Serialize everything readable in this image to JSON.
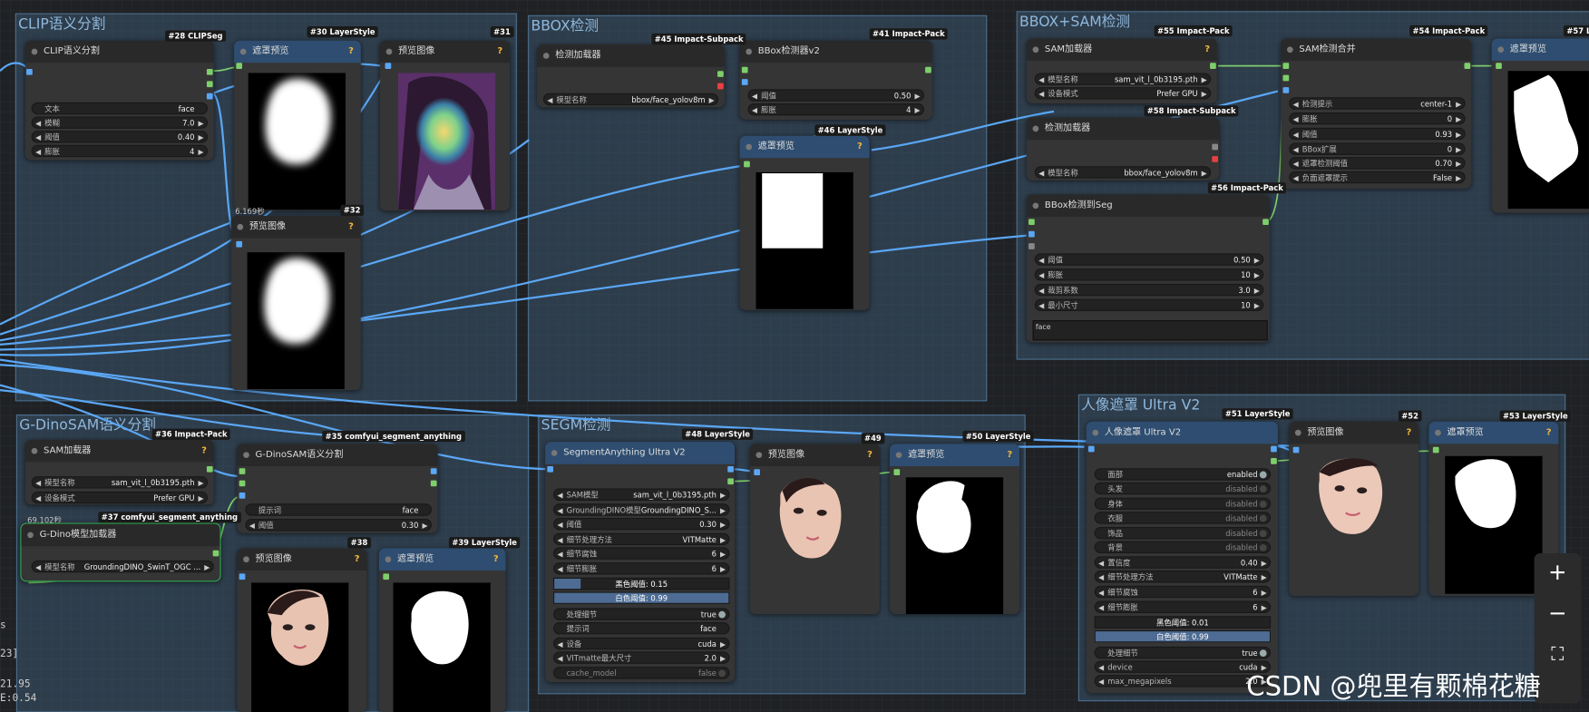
{
  "groups": {
    "clip": "CLIP语义分割",
    "bbox": "BBOX检测",
    "bboxsam": "BBOX+SAM检测",
    "gdino": "G-DinoSAM语义分割",
    "segm": "SEGM检测",
    "person": "人像遮罩 Ultra V2"
  },
  "node28": {
    "badge": "#28 CLIPSeg",
    "title": "CLIP语义分割",
    "w": [
      {
        "label": "文本",
        "value": "face"
      },
      {
        "label": "模糊",
        "value": "7.0"
      },
      {
        "label": "阈值",
        "value": "0.40"
      },
      {
        "label": "膨胀",
        "value": "4"
      }
    ]
  },
  "node30": {
    "badge": "#30 LayerStyle",
    "title": "遮罩预览",
    "time": "6.169秒"
  },
  "node31": {
    "badge": "#31",
    "title": "预览图像"
  },
  "node32": {
    "badge": "#32",
    "title": "预览图像"
  },
  "node45": {
    "badge": "#45 Impact-Subpack",
    "title": "检测加载器",
    "w": [
      {
        "label": "模型名称",
        "value": "bbox/face_yolov8m"
      }
    ]
  },
  "node41": {
    "badge": "#41 Impact-Pack",
    "title": "BBox检测器v2",
    "w": [
      {
        "label": "阈值",
        "value": "0.50"
      },
      {
        "label": "膨胀",
        "value": "4"
      }
    ]
  },
  "node46": {
    "badge": "#46 LayerStyle",
    "title": "遮罩预览"
  },
  "node55": {
    "badge": "#55 Impact-Pack",
    "title": "SAM加载器",
    "w": [
      {
        "label": "模型名称",
        "value": "sam_vit_l_0b3195.pth"
      },
      {
        "label": "设备模式",
        "value": "Prefer GPU"
      }
    ]
  },
  "node58": {
    "badge": "#58 Impact-Subpack",
    "title": "检测加载器",
    "w": [
      {
        "label": "模型名称",
        "value": "bbox/face_yolov8m"
      }
    ]
  },
  "node56": {
    "badge": "#56 Impact-Pack",
    "title": "BBox检测到Seg",
    "w": [
      {
        "label": "阈值",
        "value": "0.50"
      },
      {
        "label": "膨胀",
        "value": "10"
      },
      {
        "label": "裁剪系数",
        "value": "3.0"
      },
      {
        "label": "最小尺寸",
        "value": "10"
      }
    ],
    "text": "face"
  },
  "node54": {
    "badge": "#54 Impact-Pack",
    "title": "SAM检测合并",
    "w": [
      {
        "label": "检测提示",
        "value": "center-1"
      },
      {
        "label": "膨胀",
        "value": "0"
      },
      {
        "label": "阈值",
        "value": "0.93"
      },
      {
        "label": "BBox扩展",
        "value": "0"
      },
      {
        "label": "遮罩检测阈值",
        "value": "0.70"
      },
      {
        "label": "负面遮罩提示",
        "value": "False"
      }
    ]
  },
  "node57": {
    "badge": "#57 La",
    "title": "遮罩预览"
  },
  "node36": {
    "badge": "#36 Impact-Pack",
    "title": "SAM加载器",
    "w": [
      {
        "label": "模型名称",
        "value": "sam_vit_l_0b3195.pth"
      },
      {
        "label": "设备模式",
        "value": "Prefer GPU"
      }
    ],
    "time": "69.102秒"
  },
  "node37": {
    "badge": "#37 comfyui_segment_anything",
    "title": "G-Dino模型加载器",
    "w": [
      {
        "label": "模型名称",
        "value": "GroundingDINO_SwinT_OGC ..."
      }
    ]
  },
  "node35": {
    "badge": "#35 comfyui_segment_anything",
    "title": "G-DinoSAM语义分割",
    "w": [
      {
        "label": "提示词",
        "value": "face"
      },
      {
        "label": "阈值",
        "value": "0.30"
      }
    ]
  },
  "node38": {
    "badge": "#38",
    "title": "预览图像"
  },
  "node39": {
    "badge": "#39 LayerStyle",
    "title": "遮罩预览"
  },
  "node48": {
    "badge": "#48 LayerStyle",
    "title": "SegmentAnything Ultra V2",
    "w": [
      {
        "label": "SAM模型",
        "value": "sam_vit_l_0b3195.pth"
      },
      {
        "label": "GroundingDINO模型",
        "value": "GroundingDINO_S..."
      },
      {
        "label": "阈值",
        "value": "0.30"
      },
      {
        "label": "细节处理方法",
        "value": "VITMatte"
      },
      {
        "label": "细节腐蚀",
        "value": "6"
      },
      {
        "label": "细节膨胀",
        "value": "6"
      }
    ],
    "black": "黑色阈值: 0.15",
    "white": "白色阈值: 0.99",
    "black_ratio": 0.15,
    "w2": [
      {
        "label": "处理细节",
        "value": "true"
      },
      {
        "label": "提示词",
        "value": "face"
      },
      {
        "label": "设备",
        "value": "cuda"
      },
      {
        "label": "VITmatte最大尺寸",
        "value": "2.0"
      },
      {
        "label": "cache_model",
        "value": "false"
      }
    ]
  },
  "node49": {
    "badge": "#49",
    "title": "预览图像"
  },
  "node50": {
    "badge": "#50 LayerStyle",
    "title": "遮罩预览"
  },
  "node51": {
    "badge": "#51 LayerStyle",
    "title": "人像遮罩 Ultra V2",
    "w": [
      {
        "label": "面部",
        "value": "enabled"
      },
      {
        "label": "头发",
        "value": "disabled"
      },
      {
        "label": "身体",
        "value": "disabled"
      },
      {
        "label": "衣服",
        "value": "disabled"
      },
      {
        "label": "饰品",
        "value": "disabled"
      },
      {
        "label": "背景",
        "value": "disabled"
      },
      {
        "label": "置信度",
        "value": "0.40"
      },
      {
        "label": "细节处理方法",
        "value": "VITMatte"
      },
      {
        "label": "细节腐蚀",
        "value": "6"
      },
      {
        "label": "细节膨胀",
        "value": "6"
      }
    ],
    "black": "黑色阈值: 0.01",
    "white": "白色阈值: 0.99",
    "w2": [
      {
        "label": "处理细节",
        "value": "true"
      },
      {
        "label": "device",
        "value": "cuda"
      },
      {
        "label": "max_megapixels",
        "value": "2.0"
      }
    ]
  },
  "node52": {
    "badge": "#52",
    "title": "预览图像"
  },
  "node53": {
    "badge": "#53 LayerStyle",
    "title": "遮罩预览"
  },
  "zoom": {
    "in": "+",
    "out": "−",
    "fit": "⛶"
  },
  "watermark": "CSDN @兜里有颗棉花糖",
  "stats": {
    "s1": "s",
    "s2": "23]",
    "s3": "21.95",
    "s4": "E:0.54"
  },
  "colors": {
    "wire_image": "#5aa7f5",
    "wire_mask": "#7ecf6c",
    "group": "#3a566e"
  }
}
